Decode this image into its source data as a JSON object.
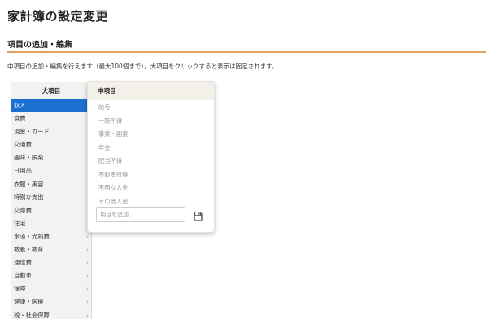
{
  "page": {
    "title": "家計簿の設定変更",
    "section_title": "項目の追加・編集",
    "description": "中項目の追加・編集を行えます（最大100個まで）。大項目をクリックすると表示は固定されます。"
  },
  "major_categories": {
    "header": "大項目",
    "selected_index": 0,
    "items": [
      {
        "label": "収入"
      },
      {
        "label": "食費"
      },
      {
        "label": "現金・カード"
      },
      {
        "label": "交通費"
      },
      {
        "label": "趣味・娯楽"
      },
      {
        "label": "日用品"
      },
      {
        "label": "衣服・美容"
      },
      {
        "label": "特別な支出"
      },
      {
        "label": "交際費"
      },
      {
        "label": "住宅"
      },
      {
        "label": "水道・光熱費"
      },
      {
        "label": "教養・教育"
      },
      {
        "label": "通信費"
      },
      {
        "label": "自動車"
      },
      {
        "label": "保険"
      },
      {
        "label": "健康・医療"
      },
      {
        "label": "税・社会保障"
      }
    ],
    "chevron": "›"
  },
  "minor_categories": {
    "header": "中項目",
    "items": [
      {
        "label": "給与"
      },
      {
        "label": "一時所得"
      },
      {
        "label": "事業・副業"
      },
      {
        "label": "年金"
      },
      {
        "label": "配当所得"
      },
      {
        "label": "不動産所得"
      },
      {
        "label": "不明な入金"
      },
      {
        "label": "その他入金"
      }
    ],
    "add_placeholder": "項目を追加",
    "save_icon": "save-icon"
  },
  "colors": {
    "accent_rule": "#e0a060",
    "selected_bg": "#1a6fd0"
  }
}
